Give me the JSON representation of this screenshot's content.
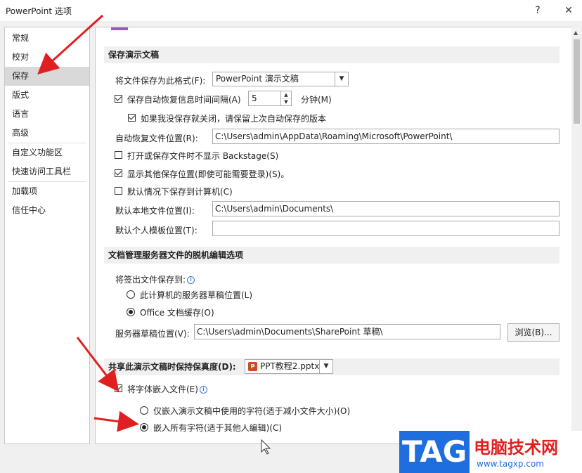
{
  "window": {
    "title": "PowerPoint 选项",
    "help_label": "?",
    "close_label": "✕"
  },
  "sidebar": {
    "items": [
      {
        "label": "常规"
      },
      {
        "label": "校对"
      },
      {
        "label": "保存",
        "active": true
      },
      {
        "label": "版式"
      },
      {
        "label": "语言"
      },
      {
        "label": "高级"
      },
      {
        "label": "自定义功能区"
      },
      {
        "label": "快速访问工具栏"
      },
      {
        "label": "加载项"
      },
      {
        "label": "信任中心"
      }
    ]
  },
  "save": {
    "section_title": "保存演示文稿",
    "format_label": "将文件保存为此格式(F):",
    "format_value": "PowerPoint 演示文稿",
    "autorecover_label": "保存自动恢复信息时间间隔(A)",
    "autorecover_checked": true,
    "autorecover_minutes": "5",
    "minutes_label": "分钟(M)",
    "keep_last_label": "如果我没保存就关闭，请保留上次自动保存的版本",
    "keep_last_checked": true,
    "autorecover_location_label": "自动恢复文件位置(R):",
    "autorecover_location_value": "C:\\Users\\admin\\AppData\\Roaming\\Microsoft\\PowerPoint\\",
    "no_backstage_label": "打开或保存文件时不显示 Backstage(S)",
    "no_backstage_checked": false,
    "show_additional_label": "显示其他保存位置(即使可能需要登录)(S)。",
    "show_additional_checked": true,
    "save_to_computer_label": "默认情况下保存到计算机(C)",
    "save_to_computer_checked": false,
    "local_location_label": "默认本地文件位置(I):",
    "local_location_value": "C:\\Users\\admin\\Documents\\",
    "templates_location_label": "默认个人模板位置(T):",
    "templates_location_value": ""
  },
  "offline": {
    "section_title": "文档管理服务器文件的脱机编辑选项",
    "checkout_label": "将签出文件保存到:",
    "option_server_label": "此计算机的服务器草稿位置(L)",
    "option_cache_label": "Office 文档缓存(O)",
    "selected": "cache",
    "drafts_label": "服务器草稿位置(V):",
    "drafts_value": "C:\\Users\\admin\\Documents\\SharePoint 草稿\\",
    "browse_label": "浏览(B)..."
  },
  "fidelity": {
    "section_title": "共享此演示文稿时保持保真度(D):",
    "file_value": "PPT教程2.pptx",
    "file_icon": "P",
    "embed_label": "将字体嵌入文件(E)",
    "embed_checked": true,
    "only_used_label": "仅嵌入演示文稿中使用的字符(适于减小文件大小)(O)",
    "all_chars_label": "嵌入所有字符(适于其他人编辑)(C)",
    "selected": "all"
  },
  "watermark": {
    "tag": "TAG",
    "cn": "电脑技术网",
    "url": "www.tagxp.com"
  },
  "colors": {
    "accent": "#1e6ee0",
    "arrow": "#e02020"
  }
}
